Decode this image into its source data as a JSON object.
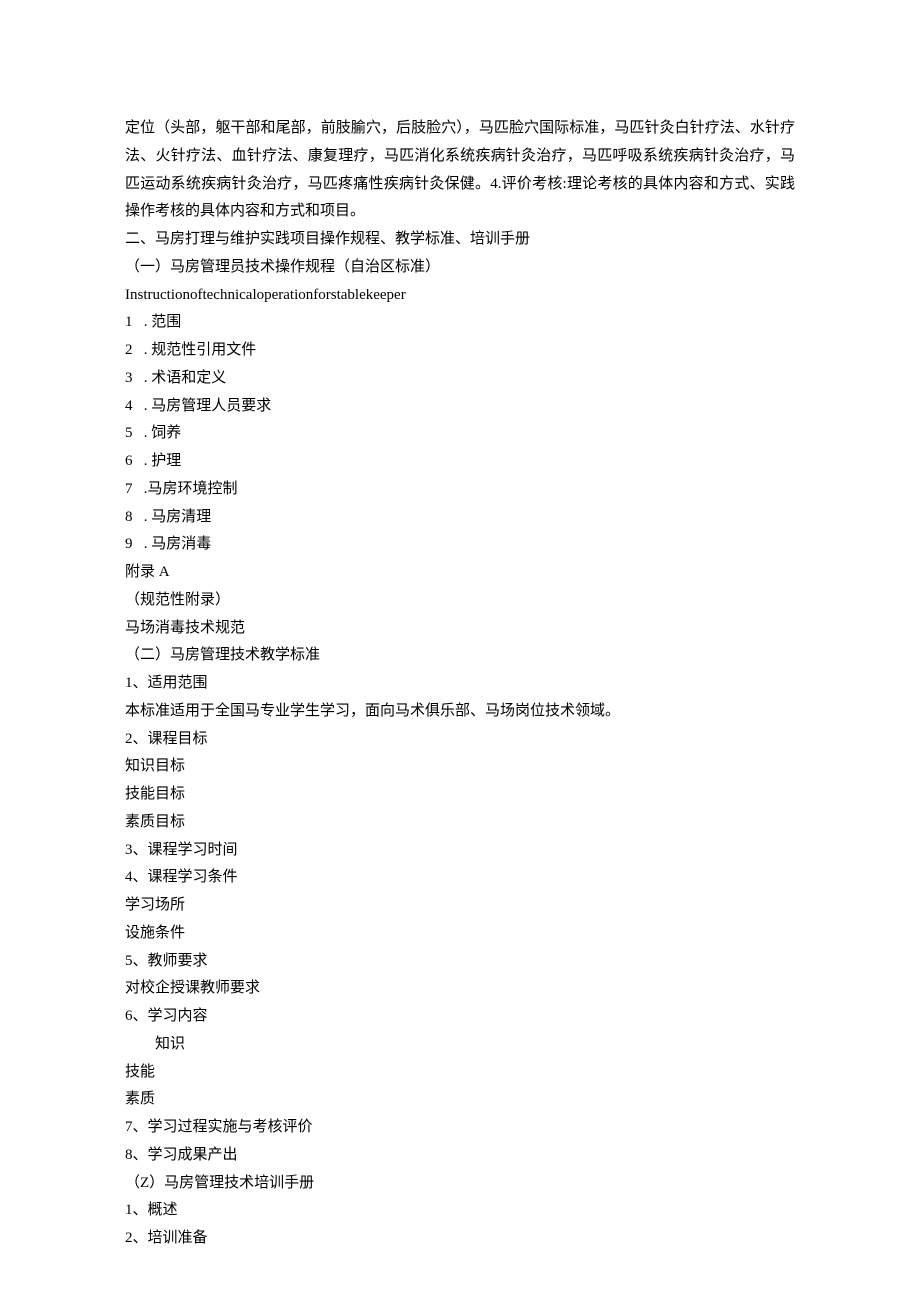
{
  "intro_paragraph": "定位（头部，躯干部和尾部，前肢腧穴，后肢脸穴），马匹脸穴国际标准，马匹针灸白针疗法、水针疗法、火针疗法、血针疗法、康复理疗，马匹消化系统疾病针灸治疗，马匹呼吸系统疾病针灸治疗，马匹运动系统疾病针灸治疗，马匹疼痛性疾病针灸保健。4.评价考核:理论考核的具体内容和方式、实践操作考核的具体内容和方式和项目。",
  "heading_2": "二、马房打理与维护实践项目操作规程、教学标准、培训手册",
  "section_1_title": "（一）马房管理员技术操作规程（自治区标准）",
  "section_1_english": "Instructionoftechnicaloperationforstablekeeper",
  "list_1": [
    {
      "num": "1",
      "sep": " .",
      "text": "范围"
    },
    {
      "num": "2",
      "sep": " .",
      "text": "规范性引用文件"
    },
    {
      "num": "3",
      "sep": " .",
      "text": "术语和定义"
    },
    {
      "num": "4",
      "sep": " .",
      "text": "马房管理人员要求"
    },
    {
      "num": "5",
      "sep": " .",
      "text": "饲养"
    },
    {
      "num": "6",
      "sep": " .",
      "text": "护理"
    },
    {
      "num": "7",
      "sep": " .",
      "text": "马房环境控制"
    },
    {
      "num": "8",
      "sep": " .",
      "text": "马房清理"
    },
    {
      "num": "9",
      "sep": " .",
      "text": "马房消毒"
    }
  ],
  "appendix_a": "附录 A",
  "appendix_a_note": "（规范性附录）",
  "appendix_a_content": "马场消毒技术规范",
  "section_2_title": "（二）马房管理技术教学标准",
  "section_2_items": [
    "1、适用范围",
    "本标准适用于全国马专业学生学习，面向马术俱乐部、马场岗位技术领域。",
    "2、课程目标",
    "知识目标",
    "技能目标",
    "素质目标",
    "3、课程学习时间",
    "4、课程学习条件",
    "学习场所",
    "设施条件",
    "5、教师要求",
    "对校企授课教师要求",
    "6、学习内容"
  ],
  "section_2_indented": "知识",
  "section_2_items_after": [
    "技能",
    "素质",
    "7、学习过程实施与考核评价",
    "8、学习成果产出"
  ],
  "section_3_title": "（Z）马房管理技术培训手册",
  "section_3_items": [
    "1、概述",
    "2、培训准备"
  ]
}
